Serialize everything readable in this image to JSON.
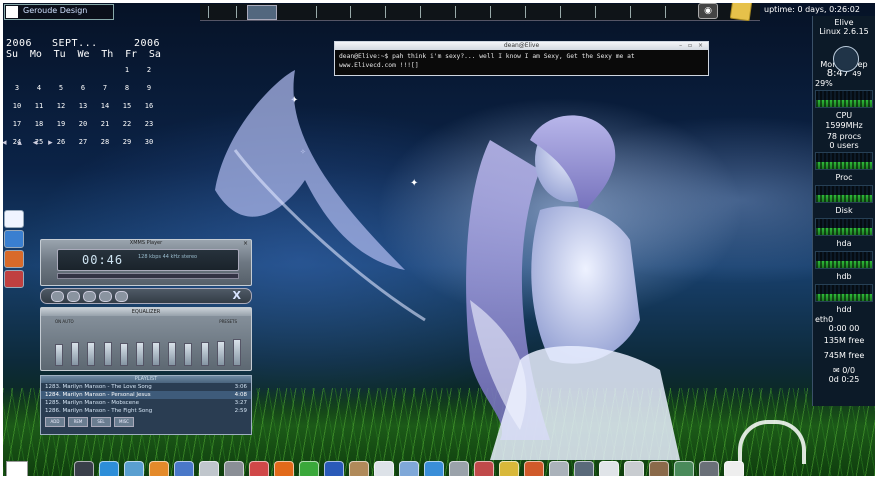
{
  "topbar": {
    "logo_text": "Geroude Design",
    "uptime": "uptime: 0 days, 0:26:02"
  },
  "calendar": {
    "year": "2006",
    "month": "SEPT...",
    "year_repeat": "2006",
    "weekdays": [
      "Su",
      "Mo",
      "Tu",
      "We",
      "Th",
      "Fr",
      "Sa"
    ],
    "days": [
      "",
      "",
      "",
      "",
      "",
      "1",
      "2",
      "3",
      "4",
      "5",
      "6",
      "7",
      "8",
      "9",
      "10",
      "11",
      "12",
      "13",
      "14",
      "15",
      "16",
      "17",
      "18",
      "19",
      "20",
      "21",
      "22",
      "23",
      "24",
      "25",
      "26",
      "27",
      "28",
      "29",
      "30"
    ],
    "nav": "◂ ▴ ◂ ▸"
  },
  "terminal": {
    "title": "dean@Elive",
    "line1": "dean@Elive:~$ pah think i'm sexy?... well I know I am Sexy, Get the Sexy me at",
    "line2": "www.Elivecd.com !!![]"
  },
  "xmms": {
    "title": "XMMS Player",
    "time": "00:46",
    "info": "128 kbps   44 kHz   stereo",
    "eq_title": "EQUALIZER",
    "eq_on": "ON  AUTO",
    "eq_presets": "PRESETS",
    "eq_levels": [
      0.55,
      0.6,
      0.62,
      0.6,
      0.58,
      0.6,
      0.62,
      0.6,
      0.58,
      0.6,
      0.65,
      0.7
    ],
    "playlist_title": "PLAYLIST",
    "playlist": [
      {
        "title": "1283. Marilyn Manson - The Love Song",
        "time": "3:06",
        "selected": false
      },
      {
        "title": "1284. Marilyn Manson - Personal Jesus",
        "time": "4:08",
        "selected": true
      },
      {
        "title": "1285. Marilyn Manson - Mobscene",
        "time": "3:27",
        "selected": false
      },
      {
        "title": "1286. Marilyn Manson - The Fight Song",
        "time": "2:59",
        "selected": false
      }
    ],
    "playlist_buttons": [
      "ADD",
      "REM",
      "SEL",
      "MISC"
    ]
  },
  "gkrellm": {
    "host": "Elive",
    "os": "Linux 2.6.15",
    "date": "Mon 11 Sep",
    "time": "8:47",
    "seconds": "49",
    "cpu_pct": "29%",
    "cpu": "CPU",
    "cpu_mhz": "1599MHz",
    "procs": "78 procs",
    "users": "0 users",
    "proc": "Proc",
    "disk": "Disk",
    "hda": "hda",
    "hdb": "hdb",
    "hdd": "hdd",
    "net_iface": "eth0",
    "net_time": "0:00 00",
    "mem1": "135M free",
    "mem2": "745M free",
    "mail": "0/0",
    "mail_time": "0d  0:25"
  },
  "colors": {
    "accent": "#2fbf3a",
    "panel": "#0c1a28",
    "terminal_bg": "#0a0a0a"
  },
  "dock_icons": [
    "terminal-icon",
    "globe-icon",
    "home-icon",
    "vlc-icon",
    "folder-icon",
    "image-icon",
    "monitor-icon",
    "camera-icon",
    "firefox-icon",
    "game-icon",
    "torrent-icon",
    "package-icon",
    "disc-icon",
    "mail-icon",
    "messenger-icon",
    "config-icon",
    "media-icon",
    "browser-icon",
    "radio-icon",
    "printer-icon",
    "search-icon",
    "screenshot-icon",
    "scanner-icon",
    "tools-icon",
    "network-icon",
    "trash-icon",
    "lightbulb-icon"
  ],
  "left_dock_icons": [
    "window-icon",
    "globe-icon",
    "firefox-icon",
    "tool-icon"
  ]
}
